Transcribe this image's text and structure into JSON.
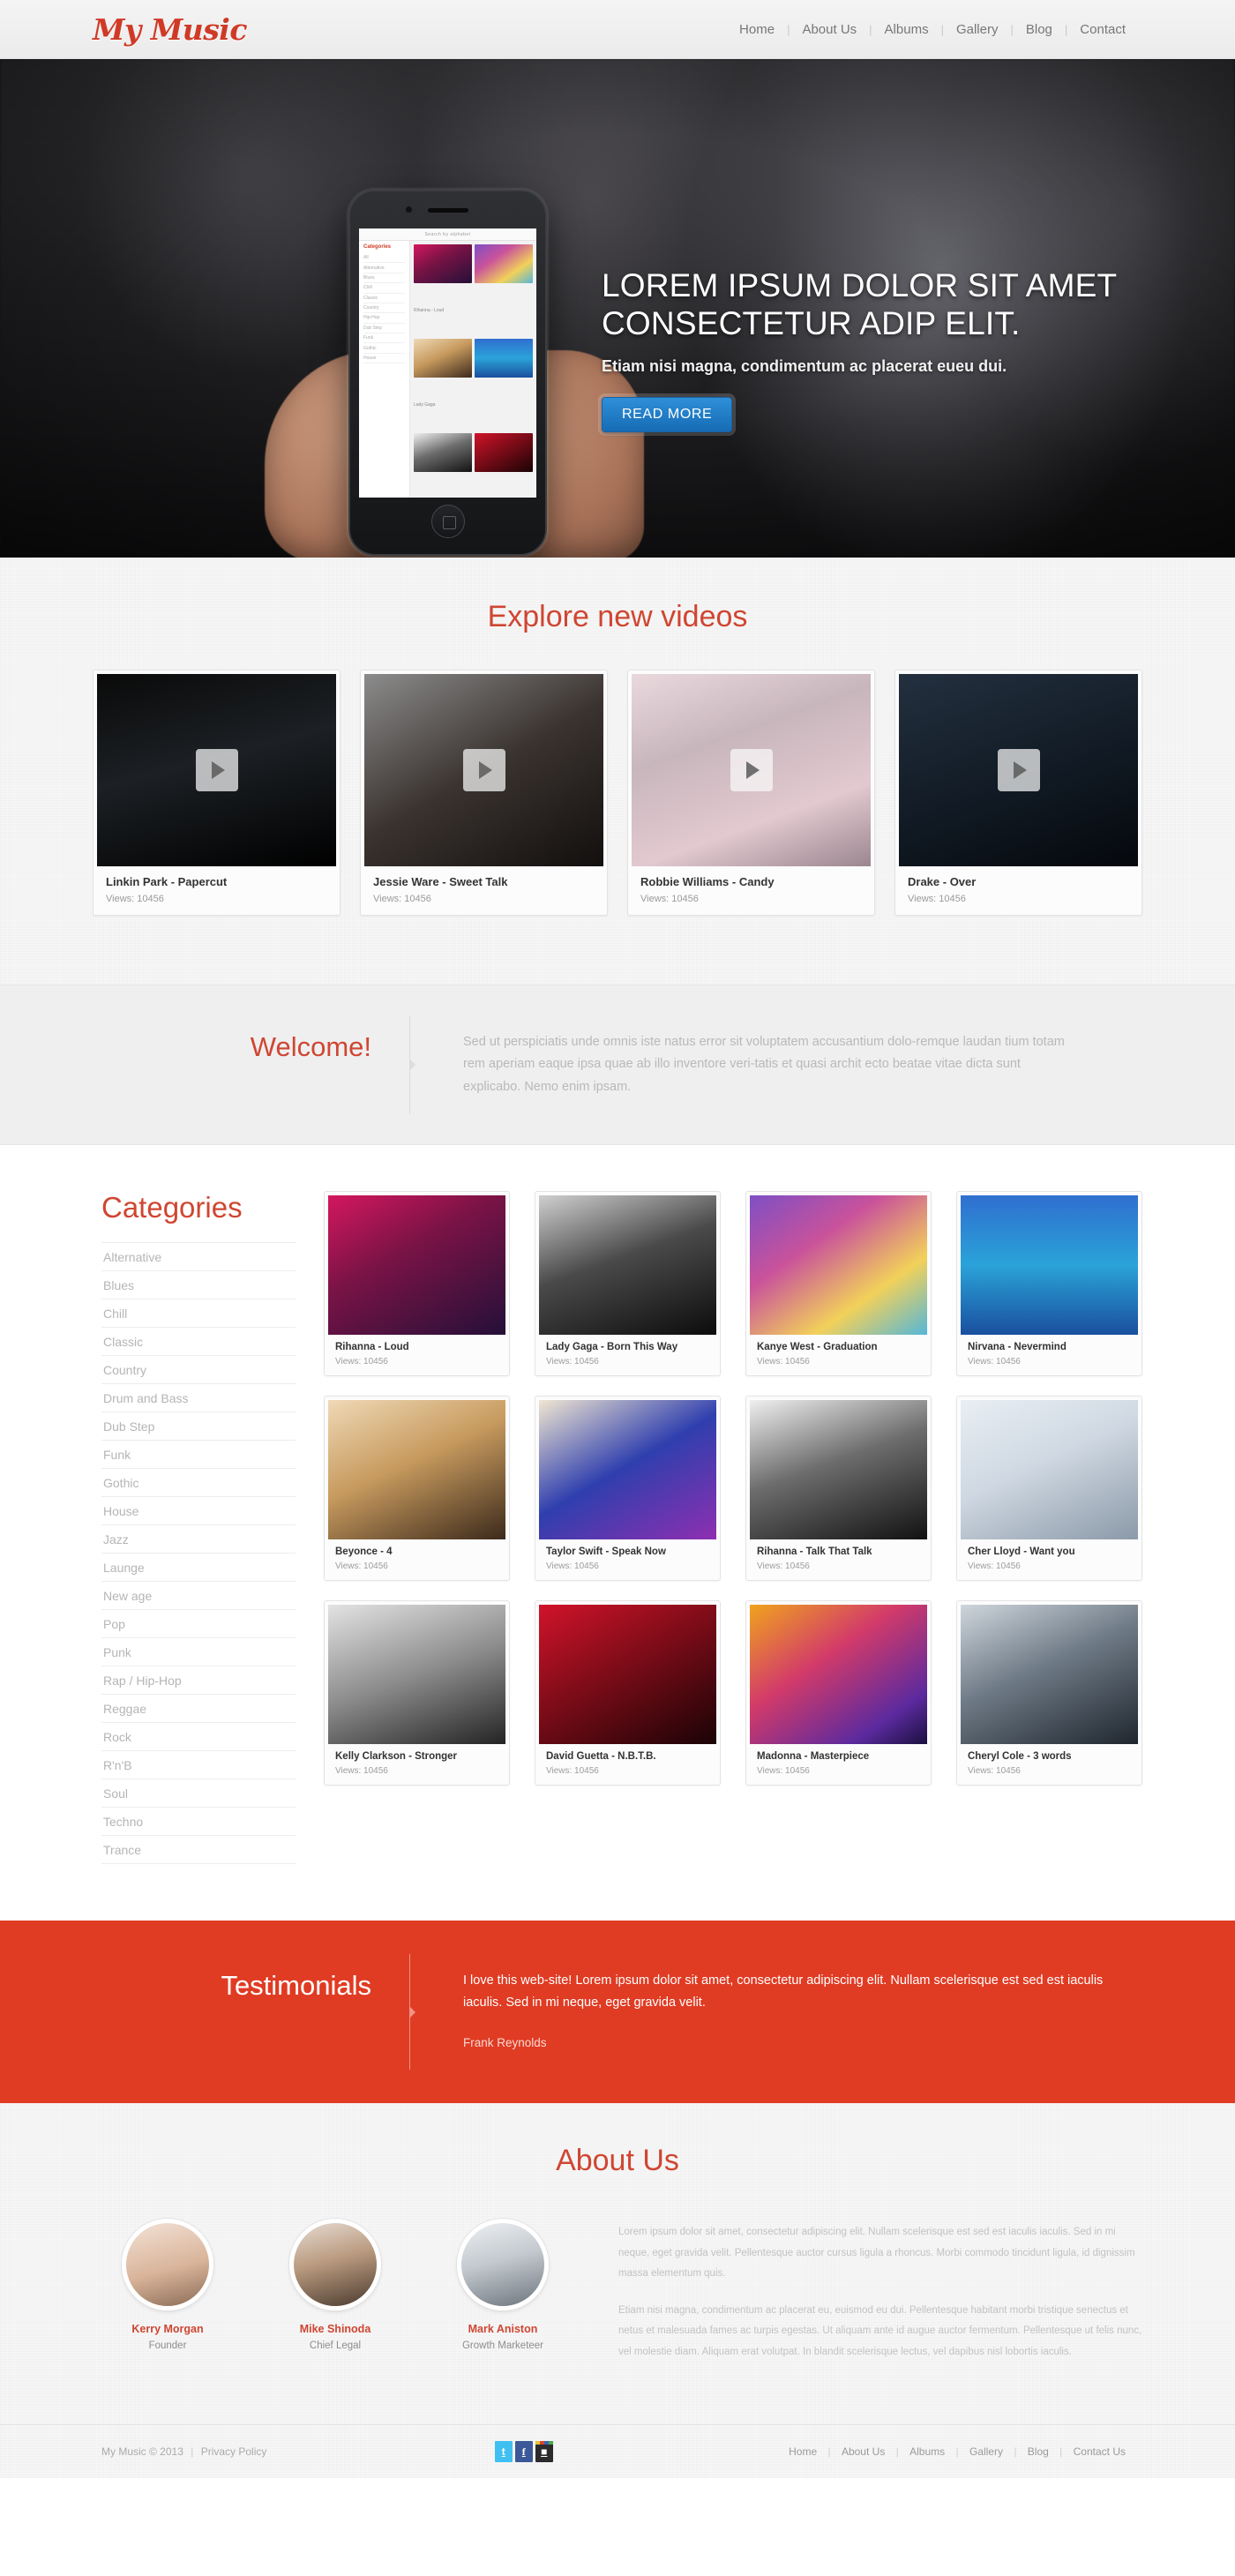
{
  "header": {
    "logo": "My Music",
    "nav": [
      {
        "label": "Home"
      },
      {
        "label": "About Us"
      },
      {
        "label": "Albums"
      },
      {
        "label": "Gallery"
      },
      {
        "label": "Blog"
      },
      {
        "label": "Contact"
      }
    ],
    "separator": "|"
  },
  "hero": {
    "title_line1": "LOREM IPSUM DOLOR SIT AMET",
    "title_line2": "CONSECTETUR ADIP ELIT.",
    "subtitle": "Etiam nisi magna, condimentum ac placerat eueu dui.",
    "button": "READ MORE",
    "button_color": "#1e78c0",
    "phone_search_placeholder": "Search by alphabet",
    "phone_sidebar_title": "Categories",
    "phone_sidebar_items": [
      "All",
      "Alternative",
      "Blues",
      "Chill",
      "Classic",
      "Country",
      "Hip-Hop",
      "Dub Step",
      "Funk",
      "Gothic",
      "House"
    ],
    "phone_caption_1": "Rihanna - Loud",
    "phone_caption_2": "Lady Gaga"
  },
  "videos": {
    "title": "Explore new videos",
    "items": [
      {
        "title": "Linkin Park - Papercut",
        "views": "Views: 10456",
        "play_icon": "play-icon"
      },
      {
        "title": "Jessie Ware - Sweet Talk",
        "views": "Views: 10456",
        "play_icon": "play-icon"
      },
      {
        "title": "Robbie Williams - Candy",
        "views": "Views: 10456",
        "play_icon": "play-icon"
      },
      {
        "title": "Drake - Over",
        "views": "Views: 10456",
        "play_icon": "play-icon"
      }
    ]
  },
  "welcome": {
    "title": "Welcome!",
    "text": "Sed ut perspiciatis unde omnis iste natus error sit voluptatem accusantium dolo-remque laudan tium totam rem aperiam eaque ipsa quae ab illo inventore veri-tatis et quasi archit ecto beatae vitae dicta sunt explicabo. Nemo enim ipsam."
  },
  "categories": {
    "title": "Categories",
    "items": [
      {
        "label": "Alternative"
      },
      {
        "label": "Blues"
      },
      {
        "label": "Chill"
      },
      {
        "label": "Classic"
      },
      {
        "label": "Country"
      },
      {
        "label": "Drum and Bass"
      },
      {
        "label": "Dub Step"
      },
      {
        "label": "Funk"
      },
      {
        "label": "Gothic"
      },
      {
        "label": "House"
      },
      {
        "label": "Jazz"
      },
      {
        "label": "Launge"
      },
      {
        "label": "New age"
      },
      {
        "label": "Pop"
      },
      {
        "label": "Punk"
      },
      {
        "label": "Rap / Hip-Hop"
      },
      {
        "label": "Reggae"
      },
      {
        "label": "Rock"
      },
      {
        "label": "R'n'B"
      },
      {
        "label": "Soul"
      },
      {
        "label": "Techno"
      },
      {
        "label": "Trance"
      }
    ]
  },
  "albums": [
    {
      "title": "Rihanna - Loud",
      "views": "Views: 10456"
    },
    {
      "title": "Lady Gaga - Born This Way",
      "views": "Views: 10456"
    },
    {
      "title": "Kanye West - Graduation",
      "views": "Views: 10456"
    },
    {
      "title": "Nirvana - Nevermind",
      "views": "Views: 10456"
    },
    {
      "title": "Beyonce - 4",
      "views": "Views: 10456"
    },
    {
      "title": "Taylor Swift - Speak Now",
      "views": "Views: 10456"
    },
    {
      "title": "Rihanna - Talk That Talk",
      "views": "Views: 10456"
    },
    {
      "title": "Cher Lloyd - Want you",
      "views": "Views: 10456"
    },
    {
      "title": "Kelly Clarkson - Stronger",
      "views": "Views: 10456"
    },
    {
      "title": "David Guetta - N.B.T.B.",
      "views": "Views: 10456"
    },
    {
      "title": "Madonna - Masterpiece",
      "views": "Views: 10456"
    },
    {
      "title": "Cheryl Cole - 3 words",
      "views": "Views: 10456"
    }
  ],
  "testimonials": {
    "title": "Testimonials",
    "quote": "I love this web-site! Lorem ipsum dolor sit amet, consectetur adipiscing elit. Nullam scelerisque est sed est iaculis iaculis. Sed in mi neque, eget gravida velit.",
    "author": "Frank Reynolds",
    "bg_color": "#e03b23"
  },
  "about": {
    "title": "About Us",
    "team": [
      {
        "name": "Kerry Morgan",
        "role": "Founder"
      },
      {
        "name": "Mike Shinoda",
        "role": "Chief Legal"
      },
      {
        "name": "Mark Aniston",
        "role": "Growth Marketeer"
      }
    ],
    "paragraph1": "Lorem ipsum dolor sit amet, consectetur adipiscing elit. Nullam scelerisque est sed est iaculis iaculis. Sed in mi neque, eget gravida velit. Pellentesque auctor cursus ligula a rhoncus. Morbi commodo tincidunt ligula, id dignissim massa elementum quis.",
    "paragraph2": "Etiam nisi magna, condimentum ac placerat eu, euismod eu dui. Pellentesque habitant morbi tristique senectus et netus et malesuada fames ac turpis egestas. Ut aliquam ante id augue auctor fermentum. Pellentesque ut felis nunc, vel molestie diam. Aliquam erat volutpat. In blandit scelerisque lectus, vel dapibus nisl lobortis iaculis."
  },
  "footer": {
    "copyright": "My Music © 2013",
    "separator": "|",
    "privacy": "Privacy Policy",
    "social": [
      {
        "name": "twitter",
        "glyph": "t"
      },
      {
        "name": "facebook",
        "glyph": "f"
      },
      {
        "name": "instagram",
        "glyph": "■"
      }
    ],
    "nav": [
      {
        "label": "Home"
      },
      {
        "label": "About Us"
      },
      {
        "label": "Albums"
      },
      {
        "label": "Gallery"
      },
      {
        "label": "Blog"
      },
      {
        "label": "Contact Us"
      }
    ]
  },
  "brand_color": "#cf4632"
}
